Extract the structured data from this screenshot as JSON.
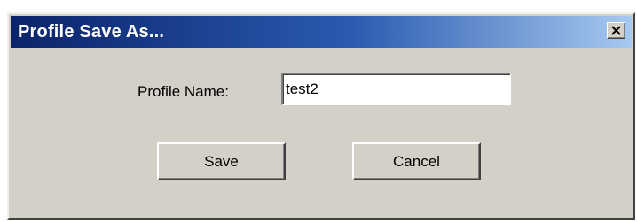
{
  "dialog": {
    "title": "Profile Save As...",
    "close_icon": "close-x-icon"
  },
  "form": {
    "profile_name_label": "Profile Name:",
    "profile_name_value": "test2"
  },
  "buttons": {
    "save_label": "Save",
    "cancel_label": "Cancel"
  },
  "colors": {
    "title_bar_start": "#0a246a",
    "title_bar_end": "#a6caf0",
    "dialog_face": "#d4d0c8"
  }
}
